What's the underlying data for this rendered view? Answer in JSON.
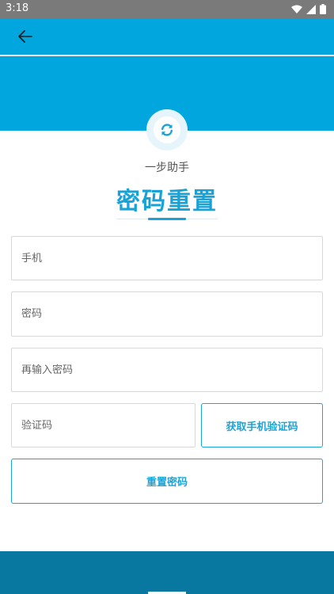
{
  "status_bar": {
    "time": "3:18",
    "icons": [
      "wifi-icon",
      "signal-icon",
      "battery-icon"
    ]
  },
  "toolbar": {
    "back_icon": "arrow-left-icon"
  },
  "logo": {
    "icon": "refresh-icon"
  },
  "header": {
    "subtitle": "一步助手",
    "title": "密码重置"
  },
  "form": {
    "phone_placeholder": "手机",
    "password_placeholder": "密码",
    "password_confirm_placeholder": "再输入密码",
    "code_placeholder": "验证码",
    "get_code_label": "获取手机验证码",
    "reset_label": "重置密码"
  },
  "colors": {
    "primary": "#00a6dd",
    "accent": "#19a2d6",
    "bottom_bar": "#0878a0",
    "status_bar": "#7a7a7a"
  }
}
